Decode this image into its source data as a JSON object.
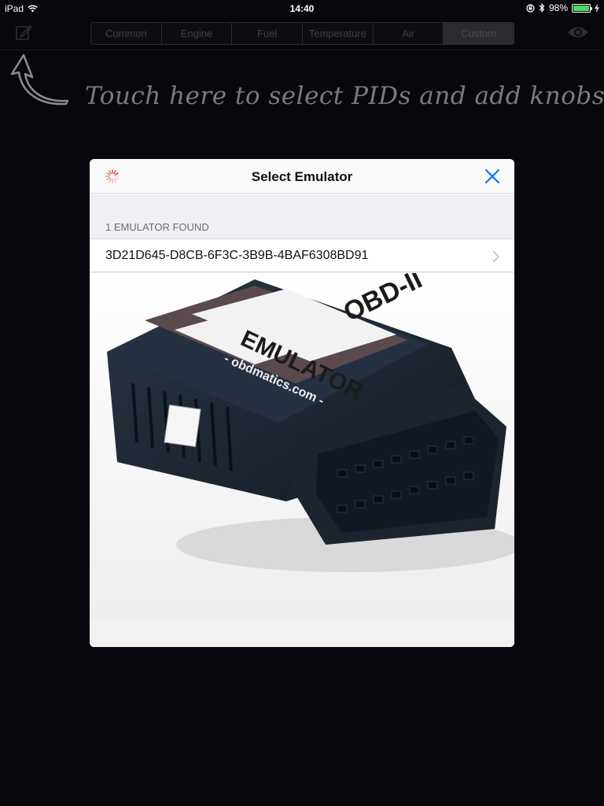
{
  "status_bar": {
    "device": "iPad",
    "time": "14:40",
    "battery_percent": "98%",
    "battery_level": 0.98,
    "icons": [
      "wifi-icon",
      "rotation-lock-icon",
      "bluetooth-icon",
      "battery-icon",
      "charging-icon"
    ]
  },
  "toolbar": {
    "edit_icon": "compose-icon",
    "view_icon": "eye-icon",
    "tabs": [
      {
        "label": "Common",
        "active": false
      },
      {
        "label": "Engine",
        "active": false
      },
      {
        "label": "Fuel",
        "active": false
      },
      {
        "label": "Temperature",
        "active": false
      },
      {
        "label": "Air",
        "active": false
      },
      {
        "label": "Custom",
        "active": true
      }
    ]
  },
  "hint": {
    "text": "Touch here to select PIDs and add knobs",
    "icon": "curved-arrow-icon"
  },
  "modal": {
    "title": "Select Emulator",
    "close_icon": "close-icon",
    "loading_icon": "activity-spinner-icon",
    "section_header": "1 EMULATOR FOUND",
    "emulators": [
      {
        "id": "3D21D645-D8CB-6F3C-3B9B-4BAF6308BD91"
      }
    ],
    "image": {
      "label_text": "OBD-II",
      "brand_text": "EMULATOR",
      "site_text": "- obdmatics.com -",
      "icon": "obd-emulator-device-image"
    }
  },
  "colors": {
    "background": "#07080d",
    "accent": "#007aff",
    "segment_border": "#2b2c31",
    "hint_text": "#7a7b80"
  }
}
